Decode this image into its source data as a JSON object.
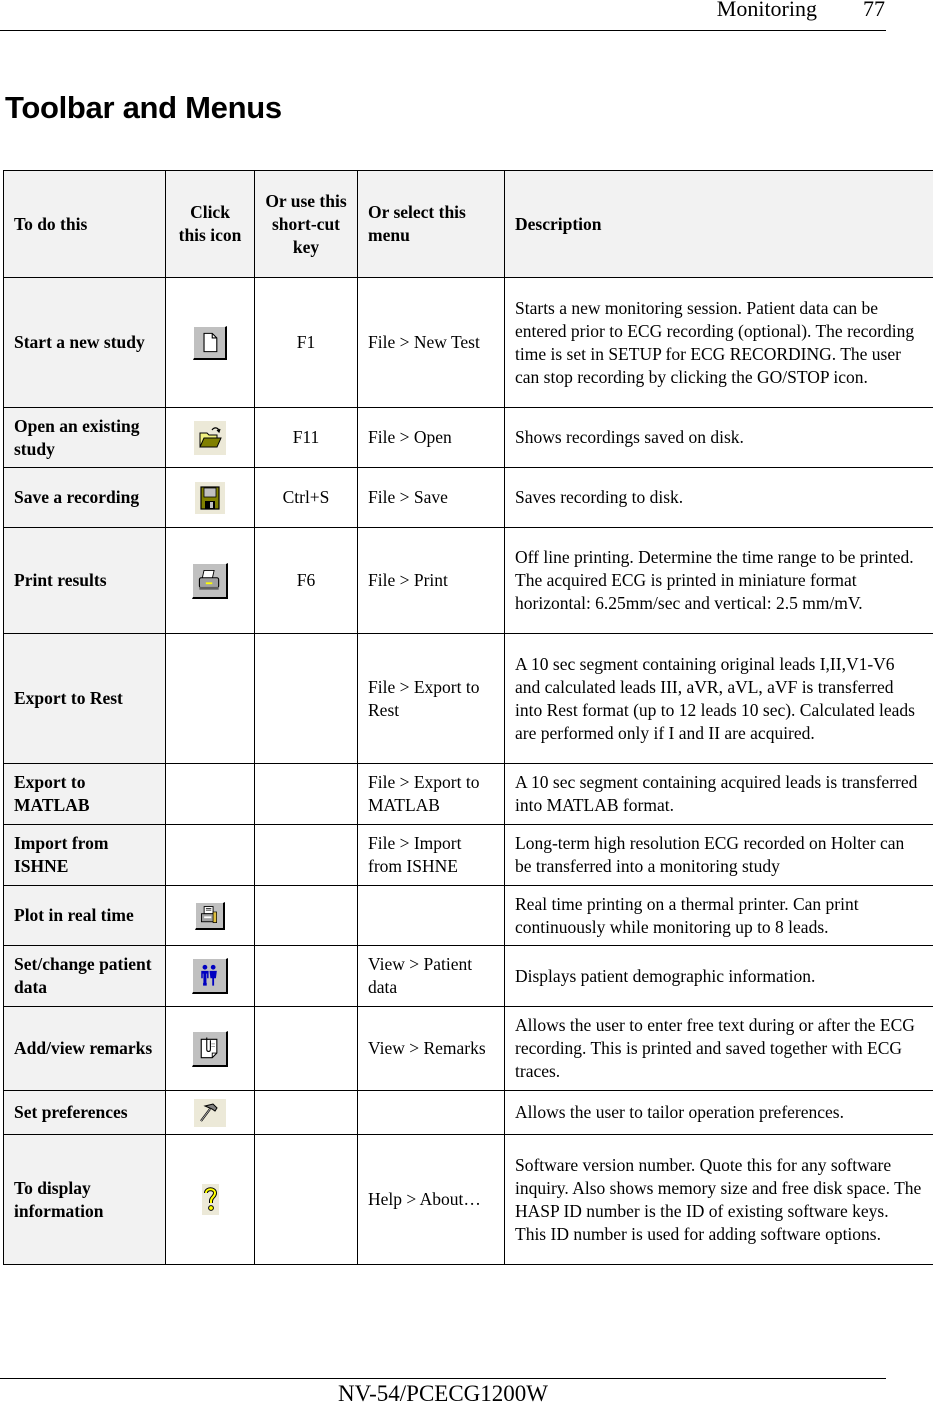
{
  "header": {
    "section": "Monitoring",
    "page_number": "77"
  },
  "title": "Toolbar and Menus",
  "table": {
    "columns": [
      "To do this",
      "Click this icon",
      "Or use this short-cut key",
      "Or select this menu",
      "Description"
    ],
    "rows": [
      {
        "task": "Start a new study",
        "icon": "new-file-icon",
        "key": "F1",
        "menu": "File > New Test",
        "description": "Starts a new monitoring session. Patient data can be entered prior to ECG recording (optional). The recording time is set in SETUP for ECG RECORDING. The user can stop recording by clicking the GO/STOP icon."
      },
      {
        "task": "Open an existing study",
        "icon": "open-folder-icon",
        "key": "F11",
        "menu": "File > Open",
        "description": "Shows recordings saved on disk."
      },
      {
        "task": "Save a recording",
        "icon": "floppy-disk-icon",
        "key": "Ctrl+S",
        "menu": "File > Save",
        "description": "Saves recording to disk."
      },
      {
        "task": "Print results",
        "icon": "printer-icon",
        "key": "F6",
        "menu": "File > Print",
        "description": "Off line printing. Determine the time range to be printed. The acquired ECG is printed in miniature format horizontal: 6.25mm/sec and vertical: 2.5 mm/mV."
      },
      {
        "task": "Export to Rest",
        "icon": "",
        "key": "",
        "menu": "File > Export to Rest",
        "description": "A 10 sec segment containing original leads I,II,V1-V6 and calculated leads III, aVR, aVL, aVF is transferred into Rest format (up to 12 leads 10 sec). Calculated leads are performed only if I and II are acquired."
      },
      {
        "task": "Export to MATLAB",
        "icon": "",
        "key": "",
        "menu": "File > Export to MATLAB",
        "description": "A 10 sec segment containing acquired leads is transferred into MATLAB format."
      },
      {
        "task": "Import from ISHNE",
        "icon": "",
        "key": "",
        "menu": "File > Import from ISHNE",
        "description": "Long-term high resolution ECG recorded on Holter can be transferred into a monitoring study"
      },
      {
        "task": "Plot in real time",
        "icon": "thermal-printer-icon",
        "key": "",
        "menu": "",
        "description": "Real time printing on a thermal printer. Can print continuously while monitoring up to 8 leads."
      },
      {
        "task": "Set/change patient data",
        "icon": "patients-icon",
        "key": "",
        "menu": "View > Patient data",
        "description": "Displays patient demographic information."
      },
      {
        "task": "Add/view remarks",
        "icon": "remarks-clipboard-icon",
        "key": "",
        "menu": "View > Remarks",
        "description": "Allows the user to enter free text during or after the ECG recording. This is printed and saved together with ECG traces."
      },
      {
        "task": "Set preferences",
        "icon": "hammer-icon",
        "key": "",
        "menu": "",
        "description": "Allows the user to tailor operation preferences."
      },
      {
        "task": "To display information",
        "icon": "help-question-icon",
        "key": "",
        "menu": "Help > About…",
        "description": "Software version number. Quote this for any software inquiry. Also shows memory size and free disk space. The HASP ID number is the ID of existing software keys. This ID number is used for adding software options."
      }
    ]
  },
  "colors": {
    "header_fill": "#f2f2f2",
    "button_face": "#c0c0c0",
    "flat_icon_bg": "#ece9d8",
    "folder_yellow": "#f0f080",
    "folder_olive": "#808000",
    "patient_blue": "#0000c0",
    "help_yellow": "#ffff00"
  },
  "footer": {
    "document_id": "NV-54/PCECG1200W"
  }
}
